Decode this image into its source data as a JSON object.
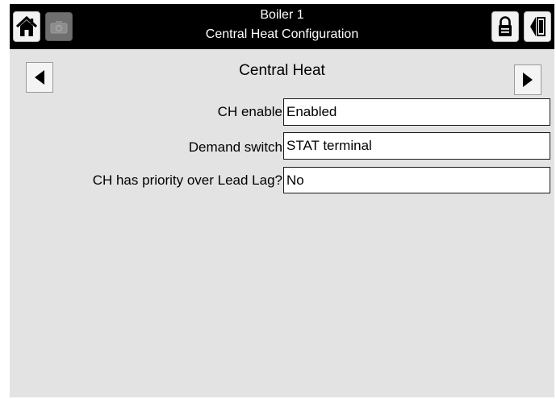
{
  "header": {
    "title_line1": "Boiler 1",
    "title_line2": "Central Heat Configuration",
    "icons": {
      "home": "home-icon",
      "camera": "camera-icon",
      "lock": "lock-icon",
      "exit": "exit-icon"
    }
  },
  "section": {
    "title": "Central Heat",
    "prev_icon": "arrow-left-icon",
    "next_icon": "arrow-right-icon"
  },
  "settings": [
    {
      "label": "CH enable",
      "value": "Enabled"
    },
    {
      "label": "Demand switch",
      "value": "STAT terminal"
    },
    {
      "label": "CH has priority over Lead Lag?",
      "value": "No"
    }
  ],
  "colors": {
    "header_bg": "#000000",
    "screen_bg": "#e3e3e3",
    "field_bg": "#ffffff",
    "text": "#000000"
  }
}
